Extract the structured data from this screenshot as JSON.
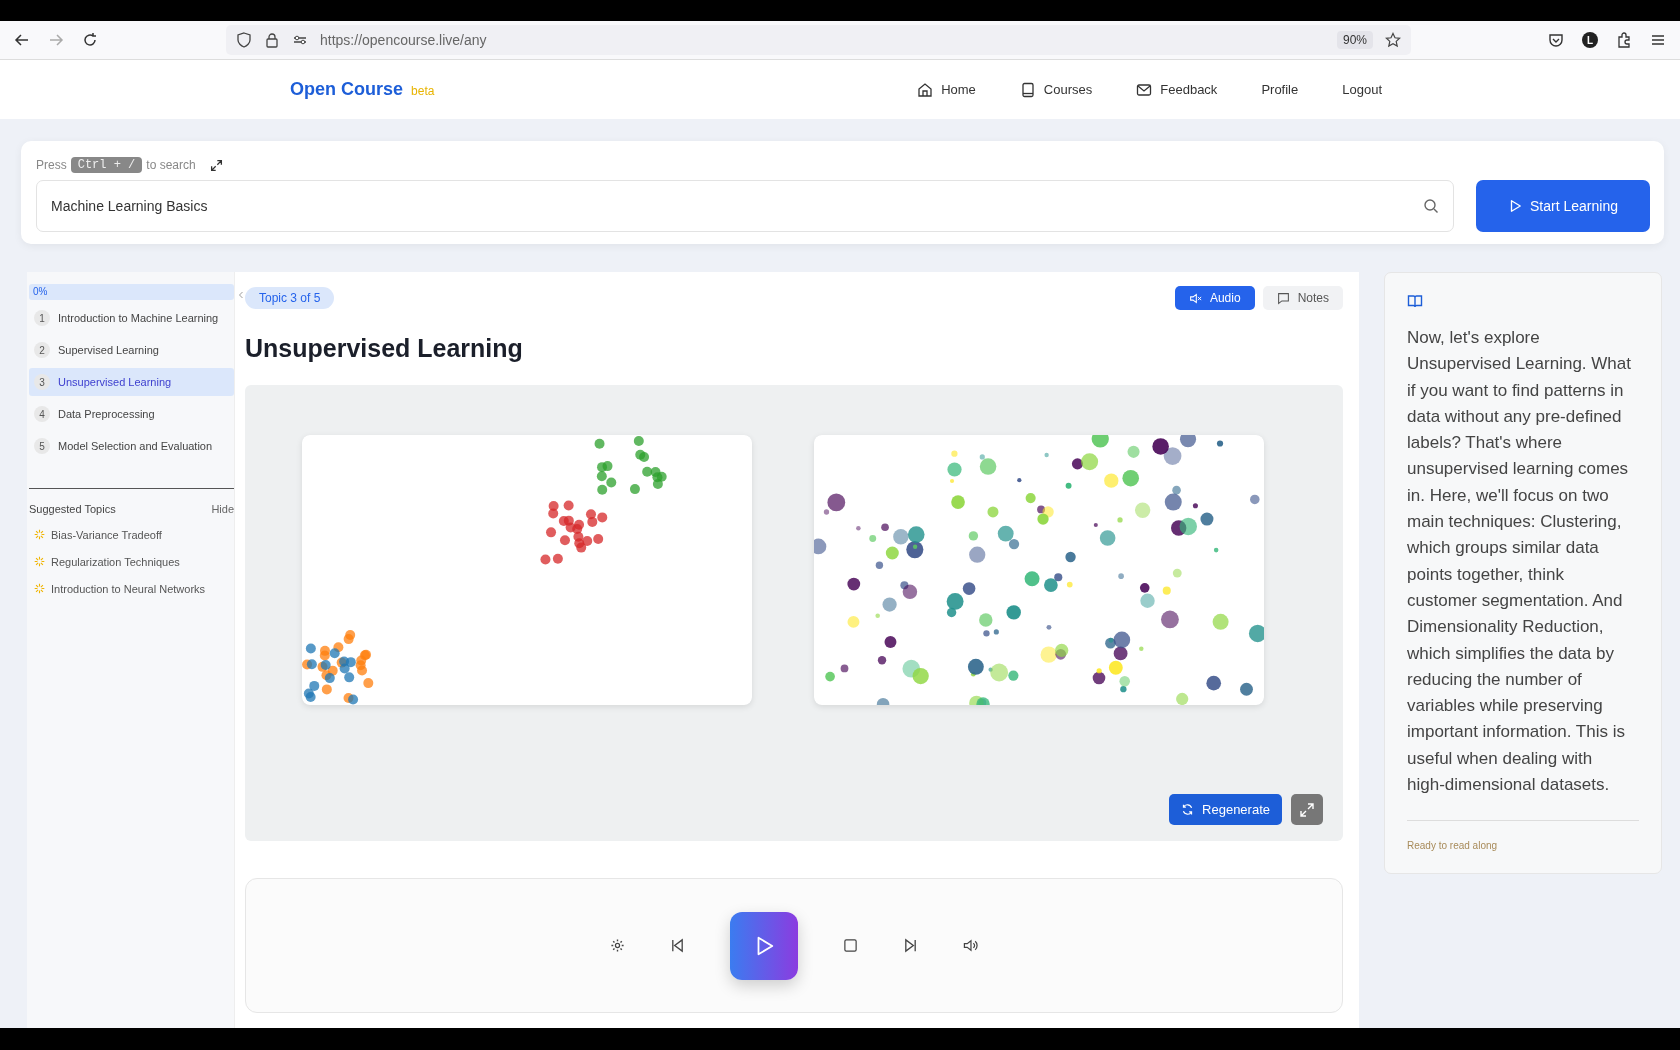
{
  "browser": {
    "url": "https://opencourse.live/any",
    "zoom": "90%",
    "profile_initial": "L"
  },
  "header": {
    "logo": "Open Course",
    "badge": "beta",
    "nav": [
      {
        "label": "Home",
        "kind": "home"
      },
      {
        "label": "Courses",
        "kind": "book"
      },
      {
        "label": "Feedback",
        "kind": "mail"
      },
      {
        "label": "Profile",
        "kind": "plain"
      },
      {
        "label": "Logout",
        "kind": "plain"
      }
    ]
  },
  "search": {
    "hint_before": "Press",
    "shortcut": "Ctrl + /",
    "hint_after": "to search",
    "value": "Machine Learning Basics",
    "button": "Start Learning"
  },
  "sidebar": {
    "progress": {
      "label": "0%",
      "level": 0
    },
    "topics": [
      {
        "number": "1",
        "title": "Introduction to Machine Learning",
        "selected": false
      },
      {
        "number": "2",
        "title": "Supervised Learning",
        "selected": false
      },
      {
        "number": "3",
        "title": "Unsupervised Learning",
        "selected": true
      },
      {
        "number": "4",
        "title": "Data Preprocessing",
        "selected": false
      },
      {
        "number": "5",
        "title": "Model Selection and Evaluation",
        "selected": false
      }
    ],
    "suggested_heading": "Suggested Topics",
    "hide": "Hide",
    "suggested": [
      "Bias-Variance Tradeoff",
      "Regularization Techniques",
      "Introduction to Neural Networks"
    ]
  },
  "lesson": {
    "chip": "Topic 3 of 5",
    "modes": [
      {
        "label": "Audio",
        "kind": "audio",
        "selected": true
      },
      {
        "label": "Notes",
        "kind": "notes",
        "selected": false
      }
    ],
    "title": "Unsupervised Learning",
    "regenerate": "Regenerate"
  },
  "reading": {
    "text": "Now, let's explore Unsupervised Learning. What if you want to find patterns in data without any pre-defined labels? That's where unsupervised learning comes in. Here, we'll focus on two main techniques: Clustering, which groups similar data points together, think customer segmentation. And Dimensionality Reduction, which simplifies the data by reducing the number of variables while preserving important information. This is useful when dealing with high-dimensional datasets.",
    "status": "Ready to read along"
  }
}
